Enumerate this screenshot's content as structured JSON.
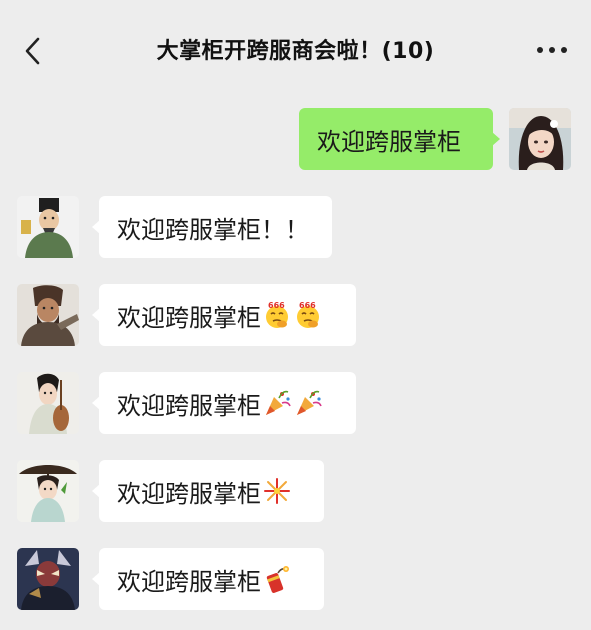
{
  "header": {
    "title": "大掌柜开跨服商会啦！(10)",
    "back_icon": "chevron-left-icon",
    "more_icon": "more-dots-icon"
  },
  "messages": [
    {
      "side": "right",
      "sender": "self",
      "text": "欢迎跨服掌柜",
      "emojis": []
    },
    {
      "side": "left",
      "sender": "scholar-in-green-robe",
      "text": "欢迎跨服掌柜！！",
      "emojis": []
    },
    {
      "side": "left",
      "sender": "bearded-warrior",
      "text": "欢迎跨服掌柜",
      "emojis": [
        "666-thinking-emoji",
        "666-thinking-emoji"
      ]
    },
    {
      "side": "left",
      "sender": "lady-with-pipa",
      "text": "欢迎跨服掌柜",
      "emojis": [
        "party-popper-emoji",
        "party-popper-emoji"
      ]
    },
    {
      "side": "left",
      "sender": "lady-with-umbrella",
      "text": "欢迎跨服掌柜",
      "emojis": [
        "fireworks-emoji"
      ]
    },
    {
      "side": "left",
      "sender": "masked-warrior",
      "text": "欢迎跨服掌柜",
      "emojis": [
        "firecracker-emoji"
      ]
    }
  ],
  "colors": {
    "background": "#ededed",
    "self_bubble": "#95ec69",
    "other_bubble": "#ffffff"
  }
}
